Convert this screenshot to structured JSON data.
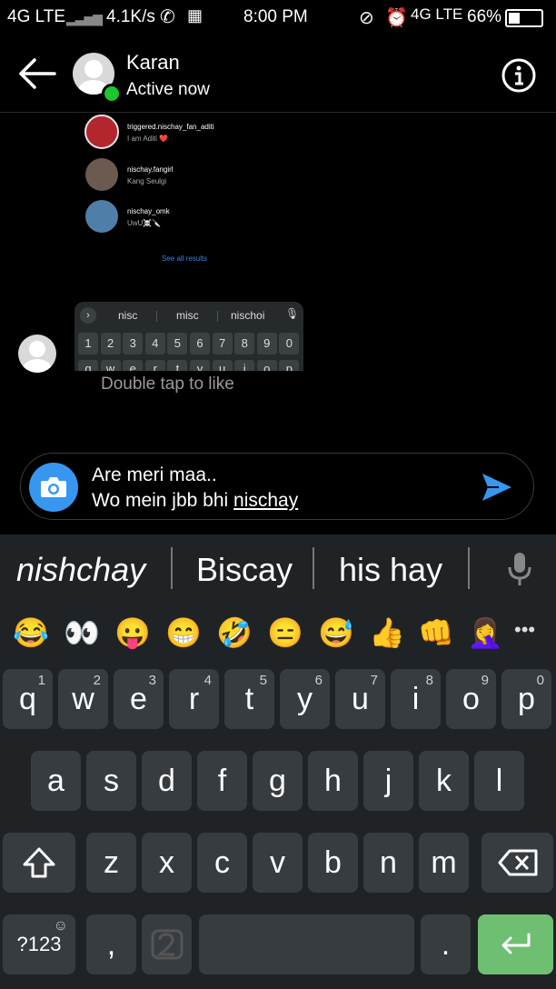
{
  "status_bar": {
    "network_left": "4G LTE",
    "speed": "4.1K/s",
    "time": "8:00 PM",
    "network_right": "4G LTE",
    "battery": "66%"
  },
  "header": {
    "contact_name": "Karan",
    "contact_status": "Active now"
  },
  "shared_screenshot": {
    "results": [
      {
        "username": "triggered.nischay_fan_aditi",
        "subtitle": "I am Aditi ❤️"
      },
      {
        "username": "nischay.fangirl",
        "subtitle": "Kang Seulgi"
      },
      {
        "username": "nischay_omk",
        "subtitle": "UwU☠️🔪"
      }
    ],
    "see_all": "See all results",
    "mini_suggestions": [
      "nisc",
      "misc",
      "nischoi"
    ],
    "mini_numbers": [
      "1",
      "2",
      "3",
      "4",
      "5",
      "6",
      "7",
      "8",
      "9",
      "0"
    ],
    "mini_letters": [
      "q",
      "w",
      "e",
      "r",
      "t",
      "y",
      "u",
      "i",
      "o",
      "p"
    ]
  },
  "message_hint": "Double tap to like",
  "composer": {
    "line1": "Are meri maa..",
    "line2_prefix": "Wo mein jbb bhi ",
    "line2_underlined": "nischay"
  },
  "keyboard": {
    "suggestions": [
      "nishchay",
      "Biscay",
      "his hay"
    ],
    "emojis": [
      "😂",
      "👀",
      "😛",
      "😁",
      "🤣",
      "😑",
      "😅",
      "👍",
      "👊",
      "🤦‍♀️"
    ],
    "more_label": "•••",
    "row1": [
      {
        "key": "q",
        "num": "1"
      },
      {
        "key": "w",
        "num": "2"
      },
      {
        "key": "e",
        "num": "3"
      },
      {
        "key": "r",
        "num": "4"
      },
      {
        "key": "t",
        "num": "5"
      },
      {
        "key": "y",
        "num": "6"
      },
      {
        "key": "u",
        "num": "7"
      },
      {
        "key": "i",
        "num": "8"
      },
      {
        "key": "o",
        "num": "9"
      },
      {
        "key": "p",
        "num": "0"
      }
    ],
    "row2": [
      "a",
      "s",
      "d",
      "f",
      "g",
      "h",
      "j",
      "k",
      "l"
    ],
    "row3": [
      "z",
      "x",
      "c",
      "v",
      "b",
      "n",
      "m"
    ],
    "symbols_key": "?123",
    "comma_key": ",",
    "period_key": "."
  },
  "colors": {
    "accent_blue": "#3797f0",
    "online_green": "#1ec52d",
    "enter_green": "#6fbf73",
    "key_bg": "#373c40",
    "keyboard_bg": "#1f2326"
  }
}
